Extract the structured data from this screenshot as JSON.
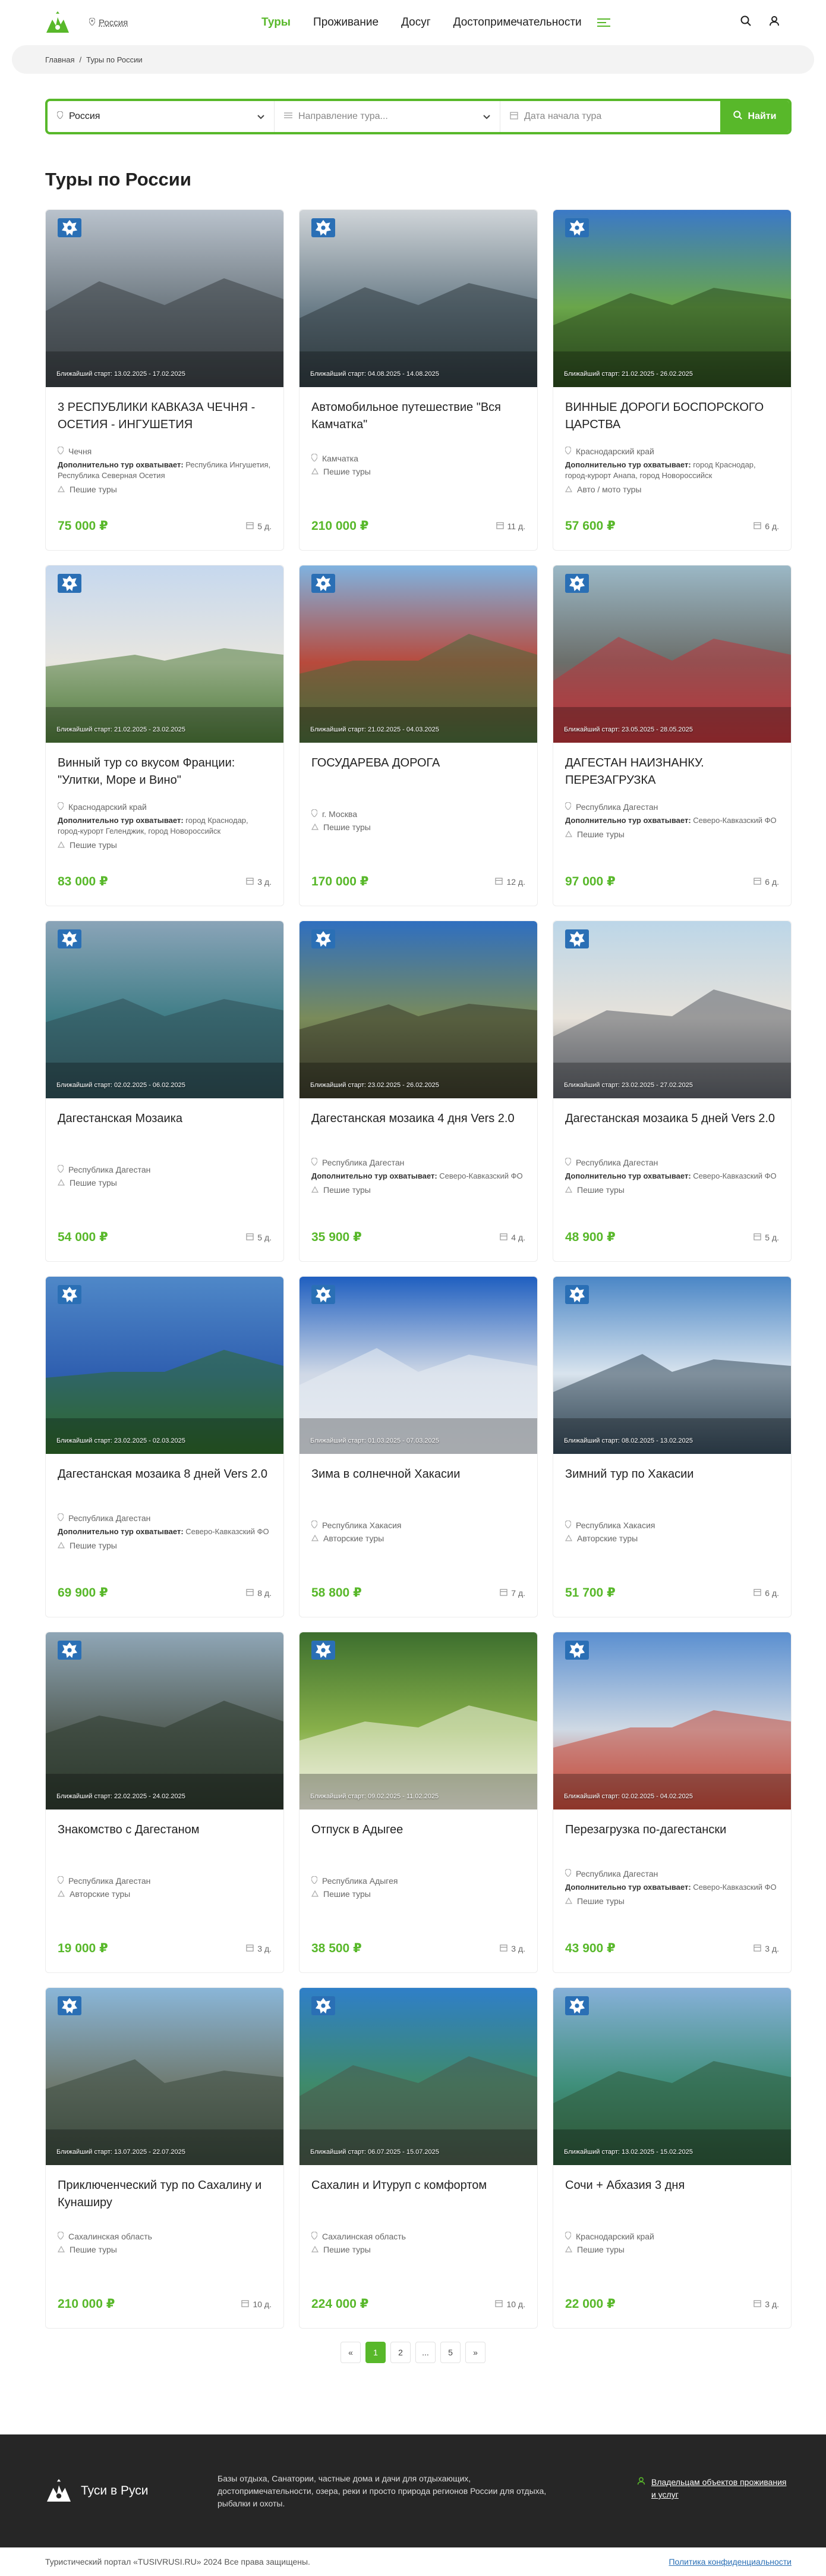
{
  "header": {
    "location": "Россия",
    "nav": [
      "Туры",
      "Проживание",
      "Досуг",
      "Достопримечательности"
    ],
    "accent": "#58b82a"
  },
  "breadcrumbs": [
    "Главная",
    "Туры по России"
  ],
  "search": {
    "region": "Россия",
    "direction_placeholder": "Направление тура...",
    "date_placeholder": "Дата начала тура",
    "button": "Найти"
  },
  "page_title": "Туры по России",
  "extra_label": "Дополнительно тур охватывает:",
  "tours": [
    {
      "start": "Ближайший старт: 13.02.2025 - 17.02.2025",
      "title": "3 РЕСПУБЛИКИ КАВКАЗА ЧЕЧНЯ - ОСЕТИЯ - ИНГУШЕТИЯ",
      "region": "Чечня",
      "extra": "Республика Ингушетия, Республика Северная Осетия",
      "type": "Пешие туры",
      "price": "75 000 ₽",
      "days": "5 д."
    },
    {
      "start": "Ближайший старт: 04.08.2025 - 14.08.2025",
      "title": "Автомобильное путешествие \"Вся Камчатка\"",
      "region": "Камчатка",
      "extra": "",
      "type": "Пешие туры",
      "price": "210 000 ₽",
      "days": "11 д."
    },
    {
      "start": "Ближайший старт: 21.02.2025 - 26.02.2025",
      "title": "ВИННЫЕ ДОРОГИ БОСПОРСКОГО ЦАРСТВА",
      "region": "Краснодарский край",
      "extra": "город Краснодар, город-курорт Анапа, город Новороссийск",
      "type": "Авто / мото туры",
      "price": "57 600 ₽",
      "days": "6 д."
    },
    {
      "start": "Ближайший старт: 21.02.2025 - 23.02.2025",
      "title": "Винный тур со вкусом Франции: \"Улитки, Море и Вино\"",
      "region": "Краснодарский край",
      "extra": "город Краснодар, город-курорт Геленджик, город Новороссийск",
      "type": "Пешие туры",
      "price": "83 000 ₽",
      "days": "3 д."
    },
    {
      "start": "Ближайший старт: 21.02.2025 - 04.03.2025",
      "title": "ГОСУДАРЕВА ДОРОГА",
      "region": "г. Москва",
      "extra": "",
      "type": "Пешие туры",
      "price": "170 000 ₽",
      "days": "12 д."
    },
    {
      "start": "Ближайший старт: 23.05.2025 - 28.05.2025",
      "title": "ДАГЕСТАН НАИЗНАНКУ. ПЕРЕЗАГРУЗКА",
      "region": "Республика Дагестан",
      "extra": "Северо-Кавказский ФО",
      "type": "Пешие туры",
      "price": "97 000 ₽",
      "days": "6 д."
    },
    {
      "start": "Ближайший старт: 02.02.2025 - 06.02.2025",
      "title": "Дагестанская Мозаика",
      "region": "Республика Дагестан",
      "extra": "",
      "type": "Пешие туры",
      "price": "54 000 ₽",
      "days": "5 д."
    },
    {
      "start": "Ближайший старт: 23.02.2025 - 26.02.2025",
      "title": "Дагестанская мозаика 4 дня Vers 2.0",
      "region": "Республика Дагестан",
      "extra": "Северо-Кавказский ФО",
      "type": "Пешие туры",
      "price": "35 900 ₽",
      "days": "4 д."
    },
    {
      "start": "Ближайший старт: 23.02.2025 - 27.02.2025",
      "title": "Дагестанская мозаика 5 дней Vers 2.0",
      "region": "Республика Дагестан",
      "extra": "Северо-Кавказский ФО",
      "type": "Пешие туры",
      "price": "48 900 ₽",
      "days": "5 д."
    },
    {
      "start": "Ближайший старт: 23.02.2025 - 02.03.2025",
      "title": "Дагестанская мозаика 8 дней Vers 2.0",
      "region": "Республика Дагестан",
      "extra": "Северо-Кавказский ФО",
      "type": "Пешие туры",
      "price": "69 900 ₽",
      "days": "8 д."
    },
    {
      "start": "Ближайший старт: 01.03.2025 - 07.03.2025",
      "title": "Зима в солнечной Хакасии",
      "region": "Республика Хакасия",
      "extra": "",
      "type": "Авторские туры",
      "price": "58 800 ₽",
      "days": "7 д."
    },
    {
      "start": "Ближайший старт: 08.02.2025 - 13.02.2025",
      "title": "Зимний тур по Хакасии",
      "region": "Республика Хакасия",
      "extra": "",
      "type": "Авторские туры",
      "price": "51 700 ₽",
      "days": "6 д."
    },
    {
      "start": "Ближайший старт: 22.02.2025 - 24.02.2025",
      "title": "Знакомство с Дагестаном",
      "region": "Республика Дагестан",
      "extra": "",
      "type": "Авторские туры",
      "price": "19 000 ₽",
      "days": "3 д."
    },
    {
      "start": "Ближайший старт: 09.02.2025 - 11.02.2025",
      "title": "Отпуск в Адыгее",
      "region": "Республика Адыгея",
      "extra": "",
      "type": "Пешие туры",
      "price": "38 500 ₽",
      "days": "3 д."
    },
    {
      "start": "Ближайший старт: 02.02.2025 - 04.02.2025",
      "title": "Перезагрузка по-дагестански",
      "region": "Республика Дагестан",
      "extra": "Северо-Кавказский ФО",
      "type": "Пешие туры",
      "price": "43 900 ₽",
      "days": "3 д."
    },
    {
      "start": "Ближайший старт: 13.07.2025 - 22.07.2025",
      "title": "Приключенческий тур по Сахалину и Кунаширу",
      "region": "Сахалинская область",
      "extra": "",
      "type": "Пешие туры",
      "price": "210 000 ₽",
      "days": "10 д."
    },
    {
      "start": "Ближайший старт: 06.07.2025 - 15.07.2025",
      "title": "Сахалин и Итуруп с комфортом",
      "region": "Сахалинская область",
      "extra": "",
      "type": "Пешие туры",
      "price": "224 000 ₽",
      "days": "10 д."
    },
    {
      "start": "Ближайший старт: 13.02.2025 - 15.02.2025",
      "title": "Сочи + Абхазия 3 дня",
      "region": "Краснодарский край",
      "extra": "",
      "type": "Пешие туры",
      "price": "22 000 ₽",
      "days": "3 д."
    }
  ],
  "pagination": [
    "«",
    "1",
    "2",
    "...",
    "5",
    "»"
  ],
  "footer": {
    "brand": "Туси в Руси",
    "description": "Базы отдыха, Санатории, частные дома и дачи для отдыхающих, достопримечательности, озера, реки и просто природа регионов России для отдыха, рыбалки и охоты.",
    "owners_link": "Владельцам объектов проживания и услуг",
    "copyright": "Туристический портал «TUSIVRUSI.RU» 2024 Все права защищены.",
    "policy": "Политика конфиденциальности"
  },
  "image_palettes": [
    [
      "#b9c2cc",
      "#6f7a82",
      "#3a3f44"
    ],
    [
      "#cfd4d8",
      "#6d7f8a",
      "#2f3b40"
    ],
    [
      "#3b79c7",
      "#6aa64a",
      "#2b4a1e"
    ],
    [
      "#c6d8ee",
      "#e8e6e0",
      "#4f7a3a"
    ],
    [
      "#7fb2e0",
      "#b84a3c",
      "#4a6a3a"
    ],
    [
      "#9bb8c6",
      "#6b6e6a",
      "#b9343a"
    ],
    [
      "#8aa4b8",
      "#3f7d86",
      "#2f4f55"
    ],
    [
      "#2f6fc0",
      "#7a8b5a",
      "#3b3a2a"
    ],
    [
      "#bcd6e8",
      "#e7e2da",
      "#5b5f66"
    ],
    [
      "#4f88c8",
      "#2f5fb0",
      "#2f6a2a"
    ],
    [
      "#1f5fc0",
      "#cfd8e6",
      "#e8ecf2"
    ],
    [
      "#4a86c6",
      "#d9e4ee",
      "#364a5a"
    ],
    [
      "#8fa6b6",
      "#55605a",
      "#2e3a2e"
    ],
    [
      "#3d6f2e",
      "#88b04a",
      "#f2f2e2"
    ],
    [
      "#5a8fd0",
      "#cfd9e4",
      "#c44a3a"
    ],
    [
      "#8ab6d8",
      "#6f7a70",
      "#3c4a3e"
    ],
    [
      "#2f7fc8",
      "#3f8a6a",
      "#4a5a4a"
    ],
    [
      "#86b0d8",
      "#3f8f7a",
      "#2f5a3a"
    ]
  ]
}
